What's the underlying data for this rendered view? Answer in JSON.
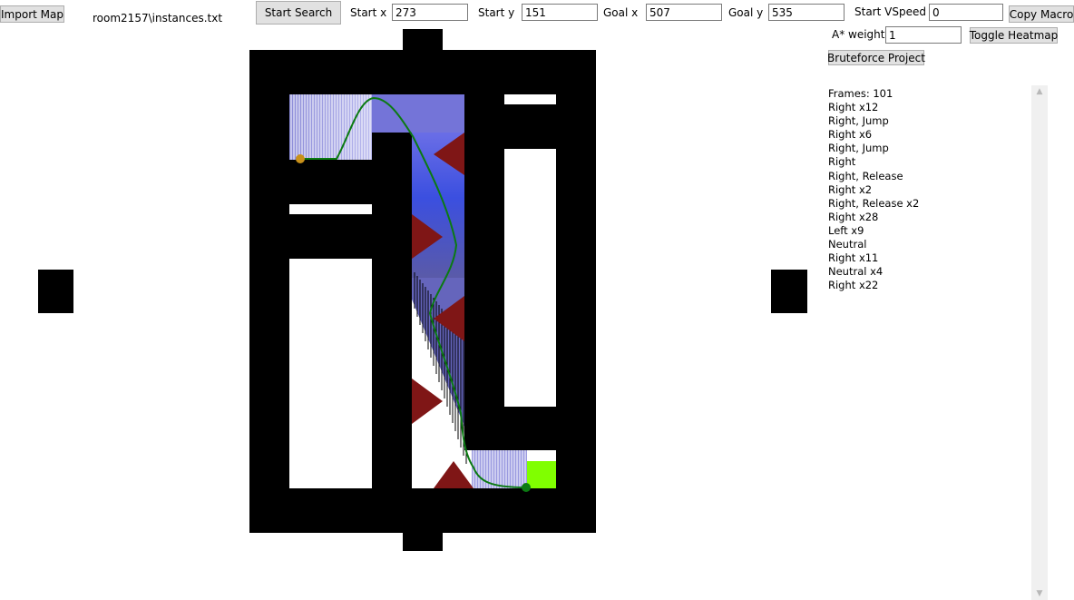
{
  "toolbar": {
    "import_map": "Import Map",
    "file_name": "room2157\\instances.txt",
    "start_search": "Start Search",
    "start_x_label": "Start x",
    "start_x_value": "273",
    "start_y_label": "Start y",
    "start_y_value": "151",
    "goal_x_label": "Goal x",
    "goal_x_value": "507",
    "goal_y_label": "Goal y",
    "goal_y_value": "535",
    "start_vspeed_label": "Start VSpeed",
    "start_vspeed_value": "0",
    "copy_macro": "Copy Macro",
    "astar_weight_label": "A* weight",
    "astar_weight_value": "1",
    "toggle_heatmap": "Toggle Heatmap",
    "bruteforce_project": "Bruteforce Project"
  },
  "macro": {
    "lines": [
      "Frames: 101",
      "Right x12",
      "Right, Jump",
      "Right x6",
      "Right, Jump",
      "Right",
      "Right, Release",
      "Right x2",
      "Right, Release x2",
      "Right x28",
      "Left x9",
      "Neutral",
      "Right x11",
      "Neutral x4",
      "Right x22"
    ]
  },
  "colors": {
    "wall": "#000000",
    "spike": "#7f1616",
    "goal": "#80ff00",
    "path": "#0b7a12",
    "start_marker": "#c8901a",
    "end_marker": "#0b7a12",
    "heat_blue": "#3b4fe0"
  }
}
